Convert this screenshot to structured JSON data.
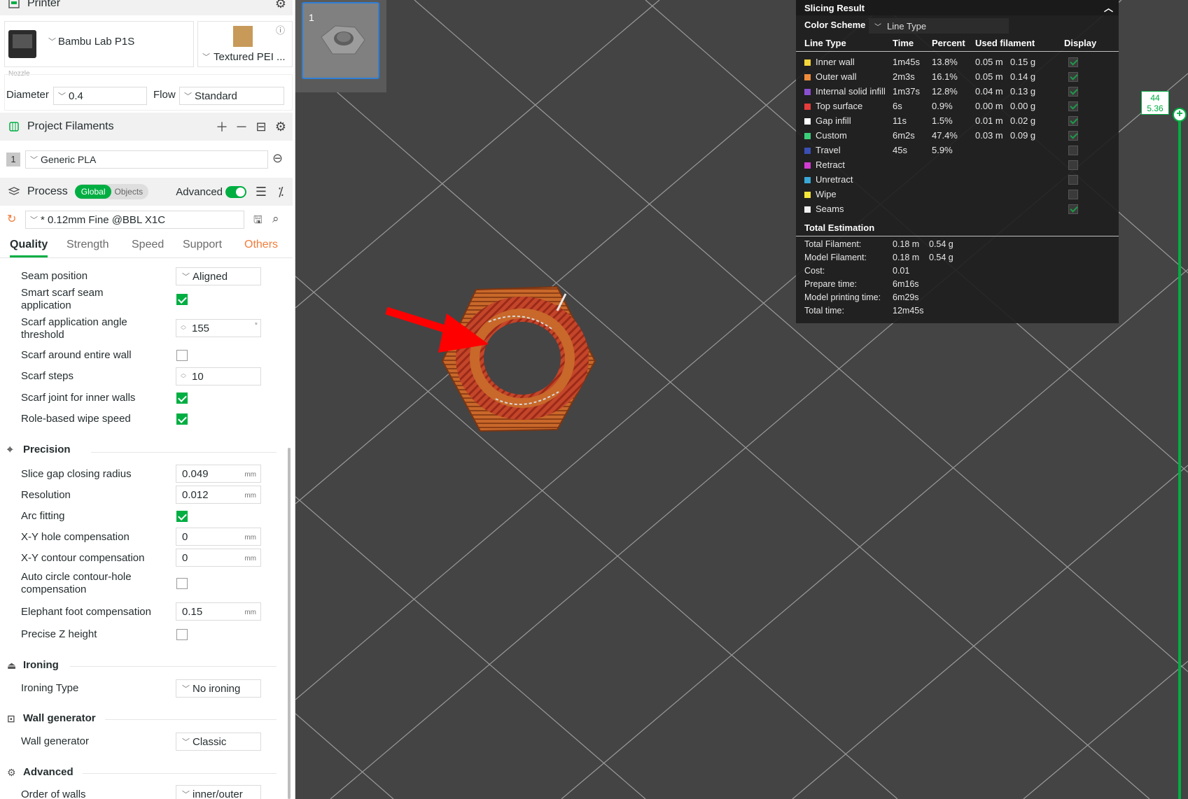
{
  "printer": {
    "section_title": "Printer",
    "printer_name": "Bambu Lab P1S",
    "plate_name": "Textured PEI ...",
    "nozzle_label": "Nozzle",
    "diameter_label": "Diameter",
    "diameter_value": "0.4",
    "flow_label": "Flow",
    "flow_value": "Standard"
  },
  "filaments": {
    "section_title": "Project Filaments",
    "items": [
      {
        "index": "1",
        "name": "Generic PLA"
      }
    ]
  },
  "process": {
    "section_title": "Process",
    "toggle_global": "Global",
    "toggle_objects": "Objects",
    "advanced_label": "Advanced",
    "preset": "* 0.12mm Fine @BBL X1C",
    "tabs": [
      "Quality",
      "Strength",
      "Speed",
      "Support",
      "Others"
    ],
    "active_tab": "Quality"
  },
  "options": {
    "seam_position": {
      "label": "Seam position",
      "value": "Aligned"
    },
    "smart_scarf": {
      "label_1": "Smart scarf seam",
      "label_2": "application",
      "checked": true
    },
    "scarf_angle": {
      "label_1": "Scarf application angle",
      "label_2": "threshold",
      "value": "155",
      "star": "*"
    },
    "scarf_entire": {
      "label": "Scarf around entire wall",
      "checked": false
    },
    "scarf_steps": {
      "label": "Scarf steps",
      "value": "10"
    },
    "scarf_inner": {
      "label": "Scarf joint for inner walls",
      "checked": true
    },
    "role_wipe": {
      "label": "Role-based wipe speed",
      "checked": true
    }
  },
  "precision": {
    "title": "Precision",
    "slice_gap": {
      "label": "Slice gap closing radius",
      "value": "0.049",
      "unit": "mm"
    },
    "resolution": {
      "label": "Resolution",
      "value": "0.012",
      "unit": "mm"
    },
    "arc_fitting": {
      "label": "Arc fitting",
      "checked": true
    },
    "xy_hole": {
      "label": "X-Y hole compensation",
      "value": "0",
      "unit": "mm"
    },
    "xy_contour": {
      "label": "X-Y contour compensation",
      "value": "0",
      "unit": "mm"
    },
    "auto_circle": {
      "label_1": "Auto circle contour-hole",
      "label_2": "compensation",
      "checked": false
    },
    "elephant": {
      "label": "Elephant foot compensation",
      "value": "0.15",
      "unit": "mm"
    },
    "precise_z": {
      "label": "Precise Z height",
      "checked": false
    }
  },
  "ironing": {
    "title": "Ironing",
    "type_label": "Ironing Type",
    "type_value": "No ironing"
  },
  "wall_gen": {
    "title": "Wall generator",
    "label": "Wall generator",
    "value": "Classic"
  },
  "advanced": {
    "title": "Advanced",
    "order_label": "Order of walls",
    "order_value": "inner/outer"
  },
  "viewport": {
    "plate_number": "1"
  },
  "slicing_result": {
    "title": "Slicing Result",
    "color_scheme_label": "Color Scheme",
    "color_scheme_value": "Line Type",
    "headers": [
      "Line Type",
      "Time",
      "Percent",
      "Used filament",
      "Display"
    ],
    "rows": [
      {
        "name": "Inner wall",
        "time": "1m45s",
        "percent": "13.8%",
        "length": "0.05 m",
        "weight": "0.15 g",
        "color": "#f5d63a",
        "display": true
      },
      {
        "name": "Outer wall",
        "time": "2m3s",
        "percent": "16.1%",
        "length": "0.05 m",
        "weight": "0.14 g",
        "color": "#f08c3c",
        "display": true
      },
      {
        "name": "Internal solid infill",
        "time": "1m37s",
        "percent": "12.8%",
        "length": "0.04 m",
        "weight": "0.13 g",
        "color": "#8a4fd1",
        "display": true
      },
      {
        "name": "Top surface",
        "time": "6s",
        "percent": "0.9%",
        "length": "0.00 m",
        "weight": "0.00 g",
        "color": "#e53c3c",
        "display": true
      },
      {
        "name": "Gap infill",
        "time": "11s",
        "percent": "1.5%",
        "length": "0.01 m",
        "weight": "0.02 g",
        "color": "#ffffff",
        "display": true
      },
      {
        "name": "Custom",
        "time": "6m2s",
        "percent": "47.4%",
        "length": "0.03 m",
        "weight": "0.09 g",
        "color": "#3ccf7a",
        "display": true
      },
      {
        "name": "Travel",
        "time": "45s",
        "percent": "5.9%",
        "length": "",
        "weight": "",
        "color": "#3a4fb5",
        "display": false
      },
      {
        "name": "Retract",
        "time": "",
        "percent": "",
        "length": "",
        "weight": "",
        "color": "#d23cd2",
        "display": false
      },
      {
        "name": "Unretract",
        "time": "",
        "percent": "",
        "length": "",
        "weight": "",
        "color": "#3aa8d6",
        "display": false
      },
      {
        "name": "Wipe",
        "time": "",
        "percent": "",
        "length": "",
        "weight": "",
        "color": "#f5e63a",
        "display": false
      },
      {
        "name": "Seams",
        "time": "",
        "percent": "",
        "length": "",
        "weight": "",
        "color": "#f0f0f0",
        "display": true
      }
    ],
    "estimation_title": "Total Estimation",
    "estimation": [
      {
        "label": "Total Filament:",
        "v1": "0.18 m",
        "v2": "0.54 g"
      },
      {
        "label": "Model Filament:",
        "v1": "0.18 m",
        "v2": "0.54 g"
      },
      {
        "label": "Cost:",
        "v1": "0.01",
        "v2": ""
      },
      {
        "label": "Prepare time:",
        "v1": "6m16s",
        "v2": ""
      },
      {
        "label": "Model printing time:",
        "v1": "6m29s",
        "v2": ""
      },
      {
        "label": "Total time:",
        "v1": "12m45s",
        "v2": ""
      }
    ]
  },
  "layer_slider": {
    "layer": "44",
    "height": "5.36"
  },
  "colors": {
    "accent": "#00ae42",
    "orange_tab": "#f27c3a",
    "viewport_bg": "#444444"
  }
}
